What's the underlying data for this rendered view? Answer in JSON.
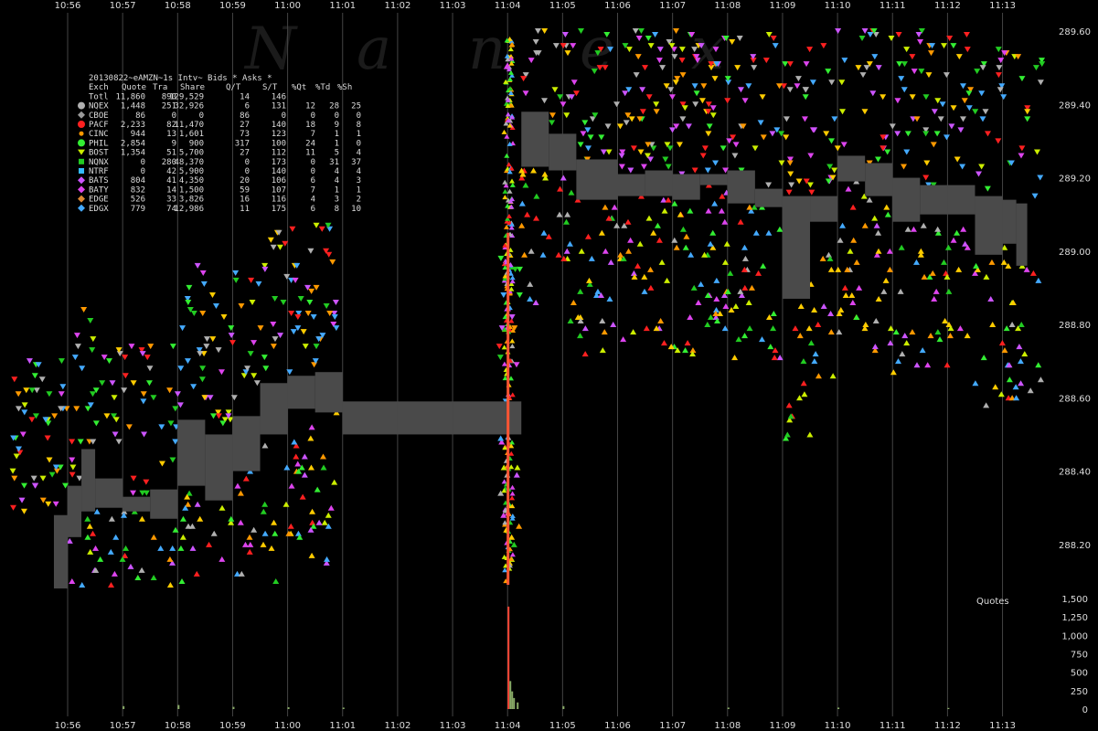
{
  "title": "20130822~eAMZN~1s Intv~ Bids * Asks *",
  "watermark": [
    "N",
    "a",
    "n",
    "e",
    "x"
  ],
  "legend": {
    "header": [
      "Exch",
      "Quote",
      "Tra",
      "Share",
      "Q/T",
      "S/T",
      "%Qt",
      "%Td",
      "%Sh"
    ],
    "rows": [
      {
        "exch": "Totl",
        "vals": [
          "11,860",
          "890",
          "129,529",
          "14",
          "146",
          "",
          "",
          ""
        ],
        "color": null,
        "marker": null
      },
      {
        "exch": "NQEX",
        "vals": [
          "1,448",
          "251",
          "32,926",
          "6",
          "131",
          "12",
          "28",
          "25"
        ],
        "color": "#b0b0b0",
        "marker": "circle"
      },
      {
        "exch": "CBOE",
        "vals": [
          "86",
          "0",
          "0",
          "86",
          "0",
          "0",
          "0",
          "0"
        ],
        "color": "#9a9a9a",
        "marker": "diamond"
      },
      {
        "exch": "PACF",
        "vals": [
          "2,233",
          "82",
          "11,470",
          "27",
          "140",
          "18",
          "9",
          "8"
        ],
        "color": "#ff2020",
        "marker": "circle"
      },
      {
        "exch": "CINC",
        "vals": [
          "944",
          "13",
          "1,601",
          "73",
          "123",
          "7",
          "1",
          "1"
        ],
        "color": "#ff9900",
        "marker": "circle-small"
      },
      {
        "exch": "PHIL",
        "vals": [
          "2,854",
          "9",
          "900",
          "317",
          "100",
          "24",
          "1",
          "0"
        ],
        "color": "#33ee33",
        "marker": "circle"
      },
      {
        "exch": "BOST",
        "vals": [
          "1,354",
          "51",
          "5,700",
          "27",
          "112",
          "11",
          "5",
          "4"
        ],
        "color": "#ccee00",
        "marker": "triangle-down"
      },
      {
        "exch": "NQNX",
        "vals": [
          "0",
          "280",
          "48,370",
          "0",
          "173",
          "0",
          "31",
          "37"
        ],
        "color": "#22cc22",
        "marker": "square"
      },
      {
        "exch": "NTRF",
        "vals": [
          "0",
          "42",
          "5,900",
          "0",
          "140",
          "0",
          "4",
          "4"
        ],
        "color": "#33bbff",
        "marker": "square"
      },
      {
        "exch": "BATS",
        "vals": [
          "804",
          "41",
          "4,350",
          "20",
          "106",
          "6",
          "4",
          "3"
        ],
        "color": "#cc55ff",
        "marker": "diamond"
      },
      {
        "exch": "BATY",
        "vals": [
          "832",
          "14",
          "1,500",
          "59",
          "107",
          "7",
          "1",
          "1"
        ],
        "color": "#dd44ee",
        "marker": "diamond"
      },
      {
        "exch": "EDGE",
        "vals": [
          "526",
          "33",
          "3,826",
          "16",
          "116",
          "4",
          "3",
          "2"
        ],
        "color": "#dd8833",
        "marker": "diamond"
      },
      {
        "exch": "EDGX",
        "vals": [
          "779",
          "74",
          "12,986",
          "11",
          "175",
          "6",
          "8",
          "10"
        ],
        "color": "#44aaff",
        "marker": "diamond"
      }
    ]
  },
  "quotes_label": "Quotes",
  "chart_data": [
    {
      "type": "scatter",
      "title": "20130822~eAMZN~1s Intv~ Bids * Asks *",
      "x_ticks": [
        "10:56",
        "10:57",
        "10:58",
        "10:59",
        "11:00",
        "11:01",
        "11:02",
        "11:03",
        "11:04",
        "11:05",
        "11:06",
        "11:07",
        "11:08",
        "11:09",
        "11:10",
        "11:11",
        "11:12",
        "11:13"
      ],
      "y_ticks": [
        "289.60",
        "289.40",
        "289.20",
        "289.00",
        "288.80",
        "288.60",
        "288.40",
        "288.20"
      ],
      "ylim": [
        288.07,
        289.61
      ],
      "grid": true,
      "nbbo_spread": [
        {
          "t": "10:55:45",
          "lo": 288.08,
          "hi": 288.28
        },
        {
          "t": "10:56:00",
          "lo": 288.22,
          "hi": 288.36
        },
        {
          "t": "10:56:15",
          "lo": 288.29,
          "hi": 288.46
        },
        {
          "t": "10:56:30",
          "lo": 288.3,
          "hi": 288.38
        },
        {
          "t": "10:57:00",
          "lo": 288.29,
          "hi": 288.33
        },
        {
          "t": "10:57:30",
          "lo": 288.27,
          "hi": 288.35
        },
        {
          "t": "10:58:00",
          "lo": 288.36,
          "hi": 288.54
        },
        {
          "t": "10:58:30",
          "lo": 288.32,
          "hi": 288.5
        },
        {
          "t": "10:59:00",
          "lo": 288.4,
          "hi": 288.55
        },
        {
          "t": "10:59:30",
          "lo": 288.5,
          "hi": 288.64
        },
        {
          "t": "11:00:00",
          "lo": 288.57,
          "hi": 288.66
        },
        {
          "t": "11:00:30",
          "lo": 288.56,
          "hi": 288.67
        },
        {
          "t": "11:01:00",
          "lo": 288.5,
          "hi": 288.59
        },
        {
          "t": "11:02:00",
          "lo": 288.5,
          "hi": 288.59
        },
        {
          "t": "11:03:00",
          "lo": 288.5,
          "hi": 288.59
        },
        {
          "t": "11:04:00",
          "lo": 288.5,
          "hi": 288.59
        },
        {
          "t": "11:04:15",
          "lo": 289.23,
          "hi": 289.38
        },
        {
          "t": "11:04:45",
          "lo": 289.22,
          "hi": 289.32
        },
        {
          "t": "11:05:15",
          "lo": 289.14,
          "hi": 289.25
        },
        {
          "t": "11:06:00",
          "lo": 289.15,
          "hi": 289.21
        },
        {
          "t": "11:06:30",
          "lo": 289.15,
          "hi": 289.22
        },
        {
          "t": "11:07:00",
          "lo": 289.14,
          "hi": 289.21
        },
        {
          "t": "11:07:30",
          "lo": 289.18,
          "hi": 289.21
        },
        {
          "t": "11:08:00",
          "lo": 289.13,
          "hi": 289.22
        },
        {
          "t": "11:08:30",
          "lo": 289.12,
          "hi": 289.17
        },
        {
          "t": "11:09:00",
          "lo": 288.87,
          "hi": 289.15
        },
        {
          "t": "11:09:30",
          "lo": 289.08,
          "hi": 289.15
        },
        {
          "t": "11:10:00",
          "lo": 289.19,
          "hi": 289.26
        },
        {
          "t": "11:10:30",
          "lo": 289.15,
          "hi": 289.24
        },
        {
          "t": "11:11:00",
          "lo": 289.08,
          "hi": 289.2
        },
        {
          "t": "11:11:30",
          "lo": 289.1,
          "hi": 289.18
        },
        {
          "t": "11:12:00",
          "lo": 289.1,
          "hi": 289.18
        },
        {
          "t": "11:12:30",
          "lo": 288.99,
          "hi": 289.15
        },
        {
          "t": "11:13:00",
          "lo": 289.02,
          "hi": 289.14
        },
        {
          "t": "11:13:15",
          "lo": 288.96,
          "hi": 289.13
        }
      ],
      "note_series": "Bid (up-triangle) and ask (down-triangle) quotes per exchange, colored per legend"
    },
    {
      "type": "bar",
      "title": "Quotes",
      "y_ticks": [
        "1,500",
        "1,250",
        "1,000",
        "750",
        "500",
        "250",
        "0"
      ],
      "ylim": [
        0,
        1500
      ],
      "bars": [
        {
          "t": "10:57:00",
          "v": 40
        },
        {
          "t": "10:58:00",
          "v": 55
        },
        {
          "t": "10:59:00",
          "v": 30
        },
        {
          "t": "11:00:00",
          "v": 25
        },
        {
          "t": "11:01:00",
          "v": 20
        },
        {
          "t": "11:04:00",
          "v": 1390
        },
        {
          "t": "11:04:02",
          "v": 380
        },
        {
          "t": "11:04:04",
          "v": 240
        },
        {
          "t": "11:04:06",
          "v": 150
        },
        {
          "t": "11:04:10",
          "v": 90
        },
        {
          "t": "11:05:00",
          "v": 40
        },
        {
          "t": "11:08:00",
          "v": 20
        },
        {
          "t": "11:10:00",
          "v": 20
        },
        {
          "t": "11:12:00",
          "v": 15
        }
      ]
    }
  ],
  "colors": {
    "grid": "#444444",
    "spread": "#4a4a4a",
    "background": "#000000"
  }
}
